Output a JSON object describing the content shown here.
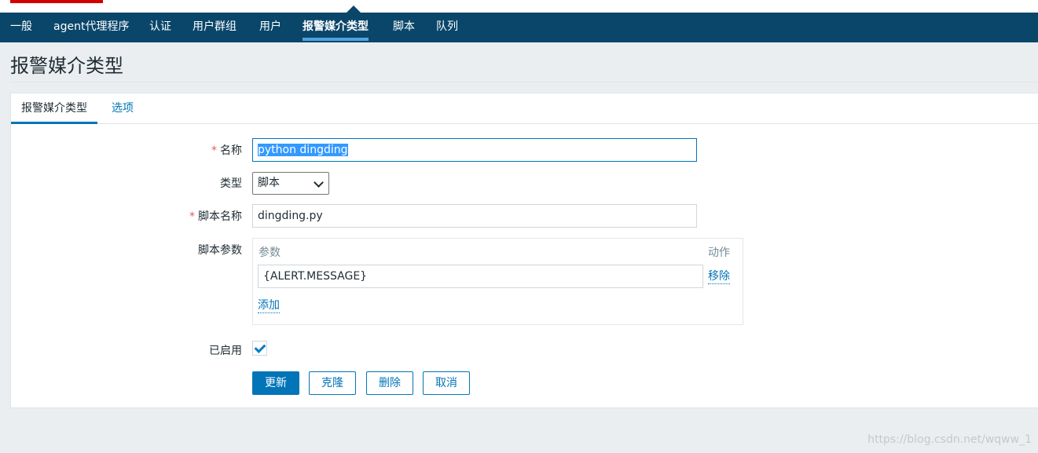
{
  "nav": {
    "items": [
      {
        "label": "一般",
        "active": false
      },
      {
        "label": "agent代理程序",
        "active": false
      },
      {
        "label": "认证",
        "active": false
      },
      {
        "label": "用户群组",
        "active": false
      },
      {
        "label": "用户",
        "active": false
      },
      {
        "label": "报警媒介类型",
        "active": true
      },
      {
        "label": "脚本",
        "active": false
      },
      {
        "label": "队列",
        "active": false
      }
    ]
  },
  "page": {
    "title": "报警媒介类型"
  },
  "tabs": [
    {
      "label": "报警媒介类型",
      "active": true
    },
    {
      "label": "选项",
      "active": false
    }
  ],
  "form": {
    "required_marker": "*",
    "name": {
      "label": "名称",
      "value": "python dingding",
      "required": true
    },
    "type": {
      "label": "类型",
      "selected": "脚本"
    },
    "script_name": {
      "label": "脚本名称",
      "value": "dingding.py",
      "required": true
    },
    "script_params": {
      "label": "脚本参数",
      "col_param": "参数",
      "col_action": "动作",
      "rows": [
        {
          "value": "{ALERT.MESSAGE}",
          "action": "移除"
        }
      ],
      "add_label": "添加"
    },
    "enabled": {
      "label": "已启用",
      "checked": true
    }
  },
  "buttons": {
    "update": "更新",
    "clone": "克隆",
    "delete": "删除",
    "cancel": "取消"
  },
  "watermark": "https://blog.csdn.net/wqww_1",
  "colors": {
    "nav_bg": "#0a466a",
    "accent": "#0275b8",
    "active_underline": "#4fa3e0",
    "required": "#e45959",
    "logo": "#d40000"
  }
}
